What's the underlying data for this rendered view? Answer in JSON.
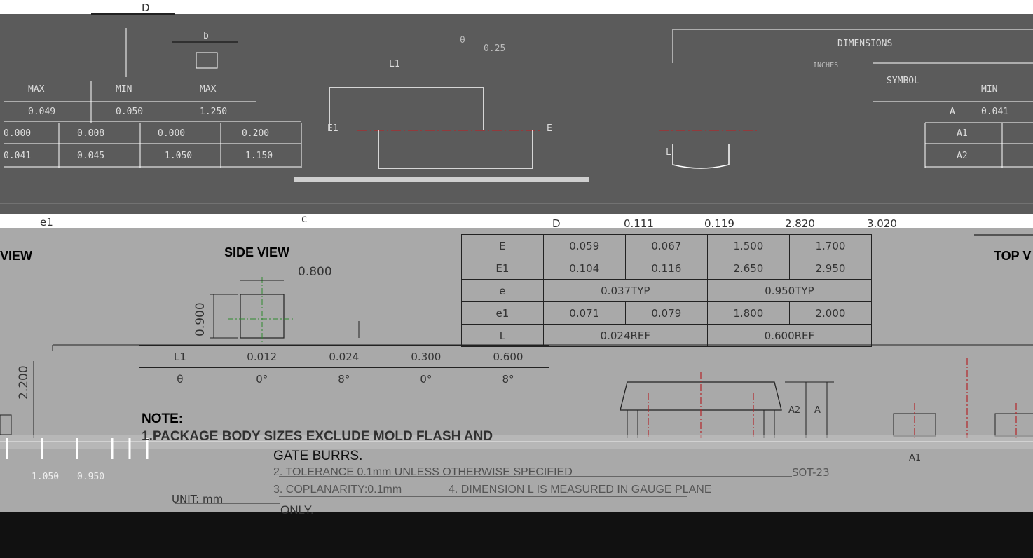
{
  "header": {
    "dimension_letter": "D"
  },
  "top_drawing": {
    "dimensions_title": "DIMENSIONS",
    "inches_label": "INCHES",
    "symbol_label": "SYMBOL",
    "label_b": "b",
    "label_theta": "θ",
    "label_025": "0.25",
    "label_L1": "L1",
    "label_E1": "E1",
    "label_E": "E",
    "label_L": "L",
    "col_labels": [
      "MAX",
      "MIN",
      "MAX"
    ],
    "row_a_values": [
      "0.049",
      "0.050",
      "1.250"
    ],
    "row_a1_values": [
      "0.000",
      "0.008",
      "0.000",
      "0.200"
    ],
    "row_a2_values": [
      "0.041",
      "0.045",
      "1.050",
      "1.150"
    ],
    "right_col": {
      "min_label": "MIN",
      "A": "A",
      "A_min": "0.041",
      "A1": "A1",
      "A2": "A2"
    }
  },
  "middle": {
    "label_e1": "e1",
    "label_c": "c",
    "side_view_title": "SIDE VIEW",
    "left_view_fragment": "VIEW",
    "top_view_fragment": "TOP V",
    "side_dims": {
      "width": "0.800",
      "height": "0.900",
      "left_height": "2.200"
    },
    "d_row": [
      "D",
      "0.111",
      "0.119",
      "2.820",
      "3.020"
    ],
    "right_table": [
      [
        "E",
        "0.059",
        "0.067",
        "1.500",
        "1.700"
      ],
      [
        "E1",
        "0.104",
        "0.116",
        "2.650",
        "2.950"
      ],
      [
        "e",
        "0.037TYP",
        "0.950TYP"
      ],
      [
        "e1",
        "0.071",
        "0.079",
        "1.800",
        "2.000"
      ],
      [
        "L",
        "0.024REF",
        "0.600REF"
      ]
    ],
    "left_table": [
      [
        "L1",
        "0.012",
        "0.024",
        "0.300",
        "0.600"
      ],
      [
        "θ",
        "0°",
        "8°",
        "0°",
        "8°"
      ]
    ],
    "profile_labels": {
      "A2": "A2",
      "A": "A",
      "A1": "A1"
    }
  },
  "notes": {
    "heading": "NOTE:",
    "line1": "1.PACKAGE BODY SIZES EXCLUDE MOLD FLASH AND",
    "line1_cont": "GATE BURRS.",
    "line2": "2. TOLERANCE 0.1mm UNLESS OTHERWISE SPECIFIED",
    "line3": "3. COPLANARITY:0.1mm",
    "line4": "4. DIMENSION L IS MEASURED IN GAUGE PLANE",
    "line5": "ONLY.",
    "unit": "UNIT: mm",
    "dims_bottom": [
      "1.050",
      "0.950"
    ],
    "package_code": "SOT-23"
  },
  "colors": {
    "top_band": "#5b5b5b",
    "mid_band": "#a9a9a9",
    "bottom_band": "#111111",
    "centerline": "#b3262b"
  }
}
